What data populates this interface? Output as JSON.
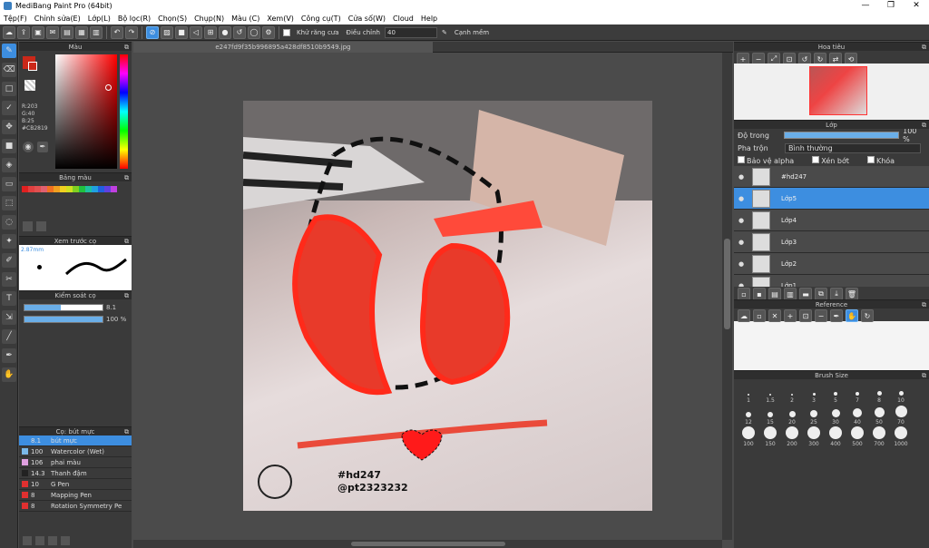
{
  "title": "MediBang Paint Pro (64bit)",
  "menu": [
    "Tệp(F)",
    "Chỉnh sửa(E)",
    "Lớp(L)",
    "Bộ lọc(R)",
    "Chọn(S)",
    "Chụp(N)",
    "Màu (C)",
    "Xem(V)",
    "Công cụ(T)",
    "Cửa số(W)",
    "Cloud",
    "Help"
  ],
  "toolbar": {
    "antialias": "Khử răng cưa",
    "adjust": "Điều chỉnh",
    "adjust_value": "40",
    "snap": "Cạnh mềm"
  },
  "color_panel": {
    "title": "Màu",
    "r": "R:203",
    "g": "G:40",
    "b": "B:25",
    "hex": "#CB2819",
    "fg": "#cb2819"
  },
  "palette": {
    "title": "Bảng màu",
    "colors": [
      "#e02020",
      "#e04040",
      "#e05050",
      "#e06070",
      "#f07020",
      "#f0a020",
      "#f0d020",
      "#d0e020",
      "#80d020",
      "#20c040",
      "#20c0a0",
      "#20a0e0",
      "#2060e0",
      "#6040e0",
      "#c040e0"
    ]
  },
  "brush_preview": {
    "title": "Xem trước cọ",
    "size": "2.87mm"
  },
  "brush_control": {
    "title": "Kiểm soát cọ",
    "size": "8.1",
    "opacity": "100 %"
  },
  "brush_list": {
    "title": "Cọ: bút mực",
    "items": [
      {
        "num": "8.1",
        "name": "bút mực",
        "color": "#3d8ee0"
      },
      {
        "num": "100",
        "name": "Watercolor (Wet)",
        "color": "#7ab8e8"
      },
      {
        "num": "106",
        "name": "phai màu",
        "color": "#e0a0e0"
      },
      {
        "num": "14.3",
        "name": "Thanh đậm",
        "color": "#222"
      },
      {
        "num": "10",
        "name": "G Pen",
        "color": "#e03030"
      },
      {
        "num": "8",
        "name": "Mapping Pen",
        "color": "#e03030"
      },
      {
        "num": "8",
        "name": "Rotation Symmetry Pe",
        "color": "#e03030"
      }
    ]
  },
  "canvas": {
    "file": "e247fd9f35b996895a428df8510b9549.jpg",
    "text1": "#hd247",
    "text2": "@pt2323232"
  },
  "navigator": {
    "title": "Hoa tiêu"
  },
  "layer_panel": {
    "title": "Lớp",
    "opacity_label": "Độ trong",
    "opacity": "100 %",
    "blend_label": "Pha trộn",
    "blend": "Bình thường",
    "protect": "Bảo vệ alpha",
    "clip": "Xén bớt",
    "lock": "Khóa",
    "layers": [
      {
        "name": "#hd247"
      },
      {
        "name": "Lớp5"
      },
      {
        "name": "Lớp4"
      },
      {
        "name": "Lớp3"
      },
      {
        "name": "Lớp2"
      },
      {
        "name": "Lớp1"
      }
    ]
  },
  "reference": {
    "title": "Reference"
  },
  "brush_size": {
    "title": "Brush Size",
    "sizes": [
      "1",
      "1.5",
      "2",
      "3",
      "5",
      "7",
      "8",
      "10",
      "12",
      "15",
      "20",
      "25",
      "30",
      "40",
      "50",
      "70",
      "100",
      "150",
      "200",
      "300",
      "400",
      "500",
      "700",
      "1000"
    ]
  }
}
